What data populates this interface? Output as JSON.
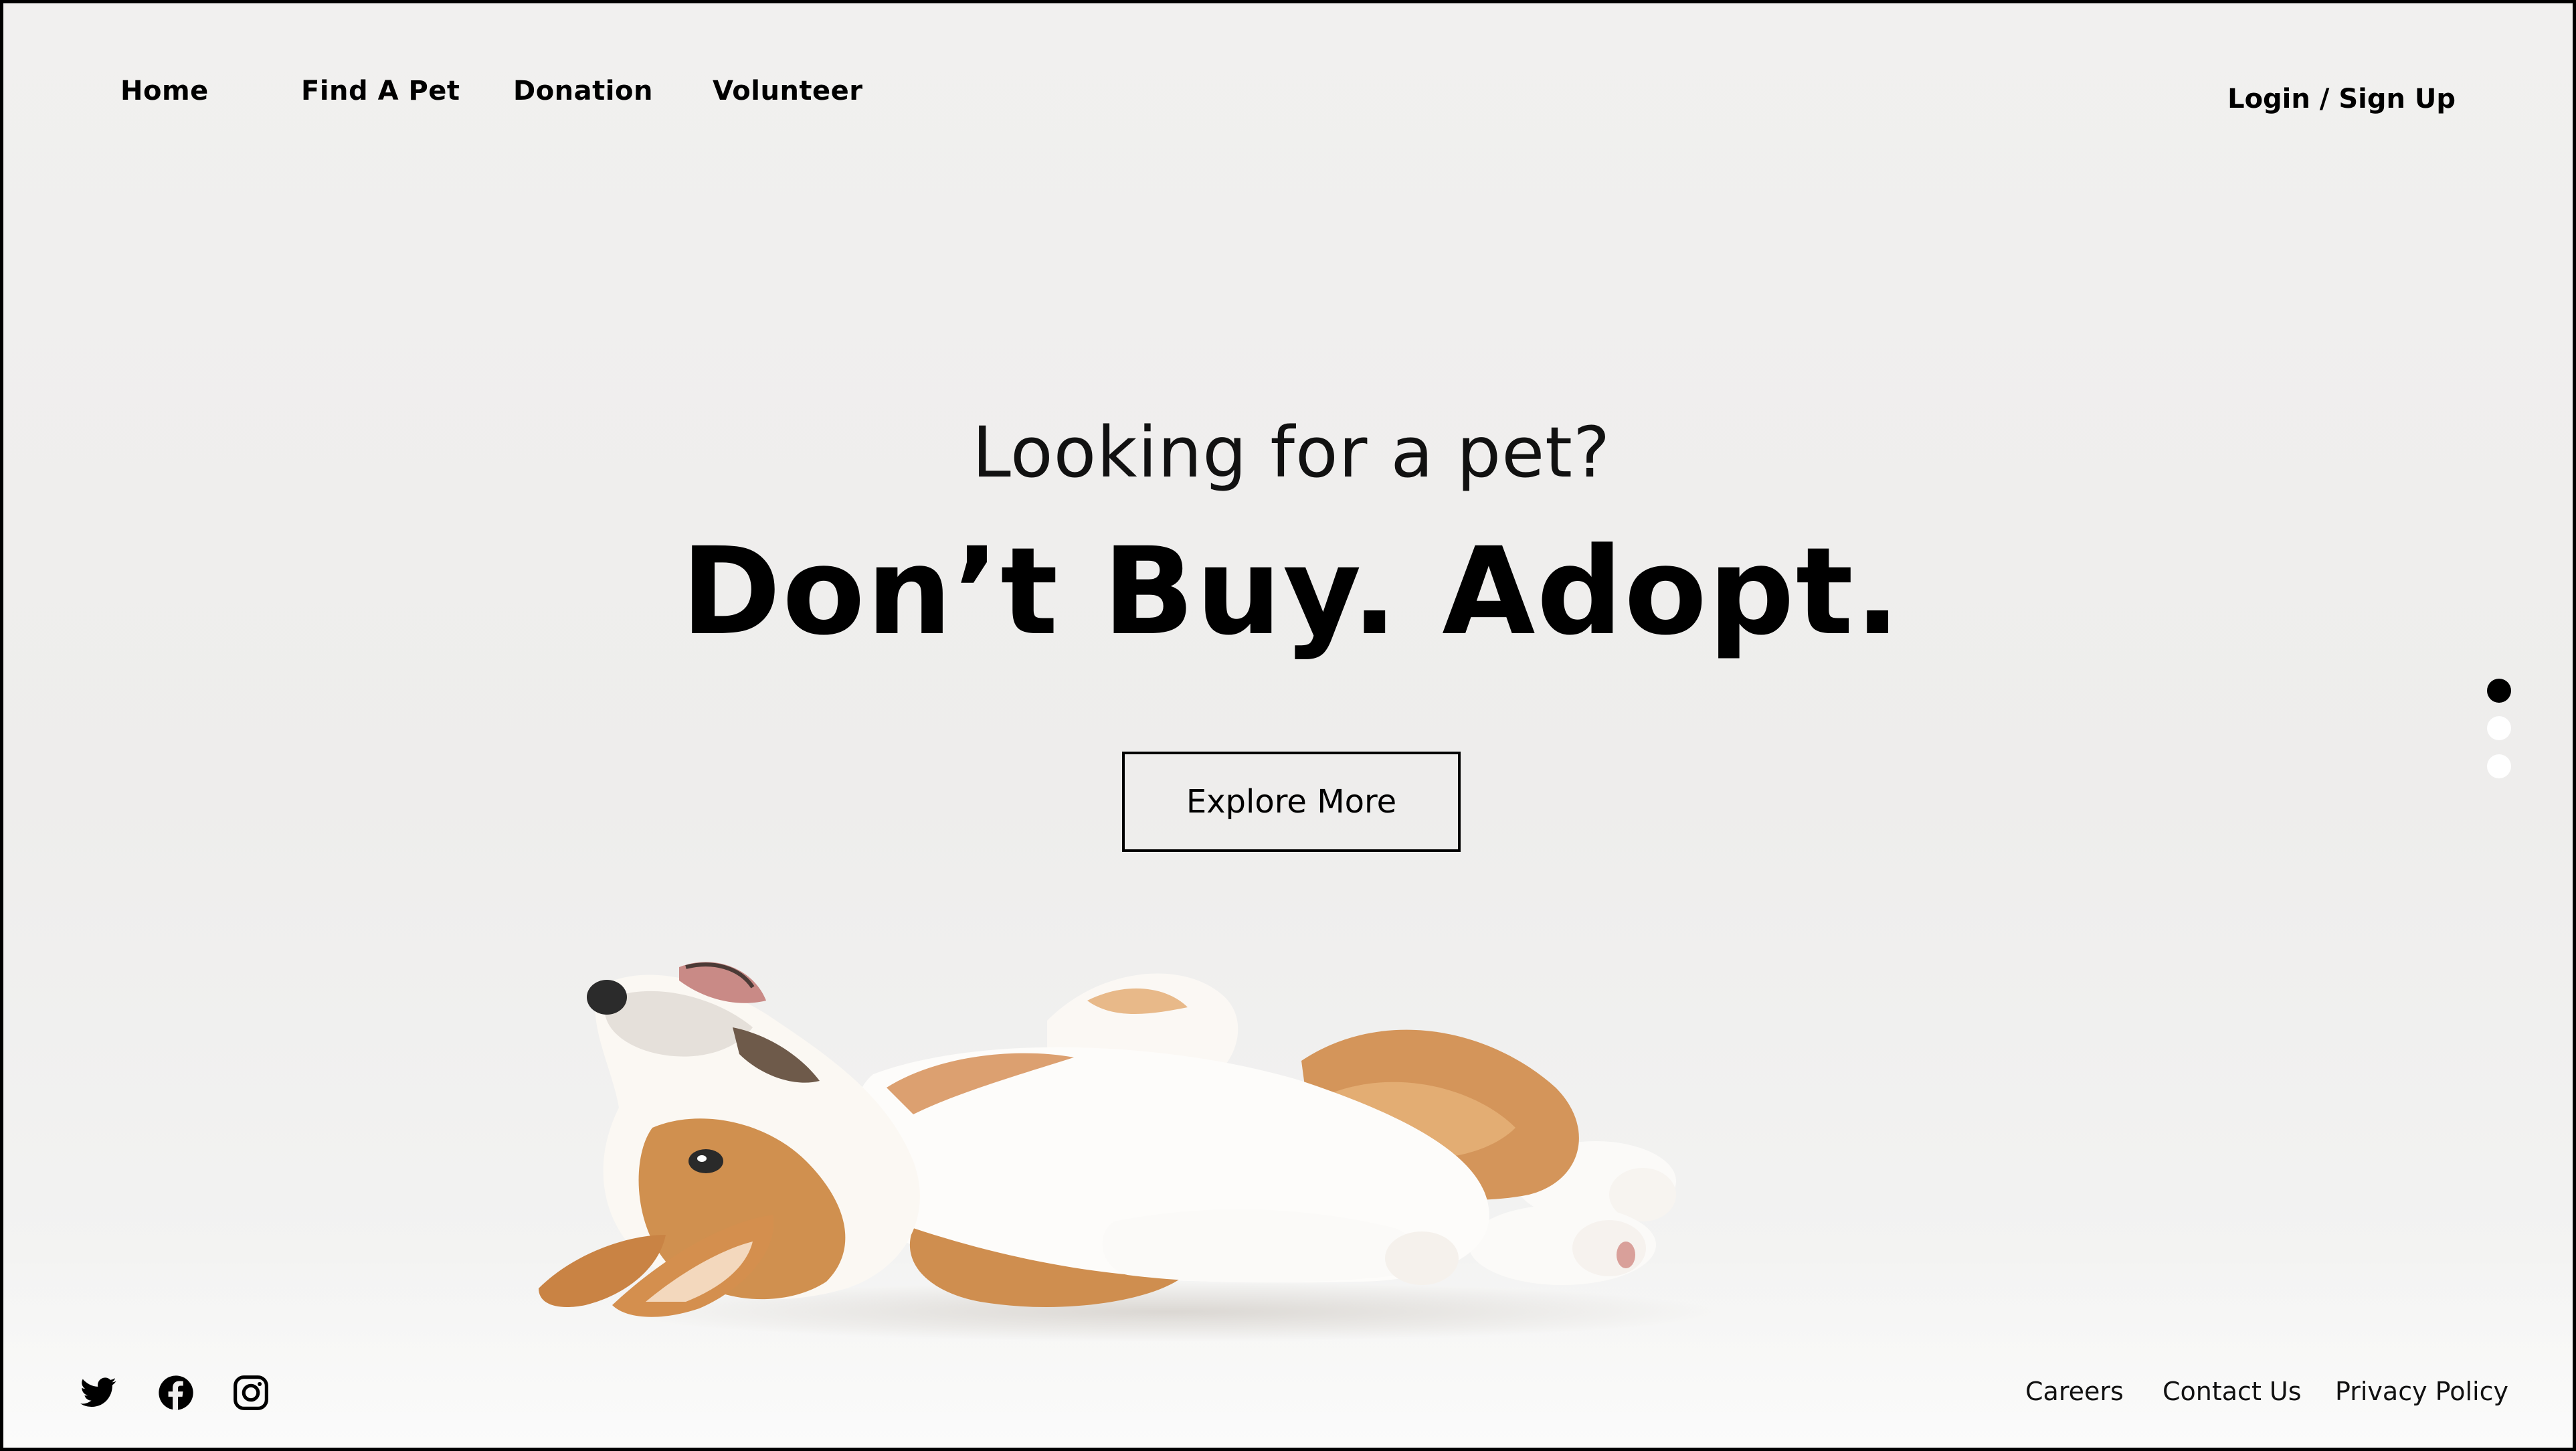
{
  "nav": {
    "items": [
      {
        "label": "Home"
      },
      {
        "label": "Find A Pet"
      },
      {
        "label": "Donation"
      },
      {
        "label": "Volunteer"
      }
    ],
    "login_label": "Login / Sign Up"
  },
  "hero": {
    "subtitle": "Looking for a pet?",
    "title": "Don’t Buy. Adopt.",
    "cta_label": "Explore More"
  },
  "carousel": {
    "slide_count": 3,
    "active_index": 0
  },
  "image": {
    "subject": "corgi puppy lying on its back"
  },
  "footer": {
    "social_icons": [
      "twitter-icon",
      "facebook-icon",
      "instagram-icon"
    ],
    "links": [
      {
        "label": "Careers"
      },
      {
        "label": "Contact Us"
      },
      {
        "label": "Privacy Policy"
      }
    ]
  },
  "colors": {
    "background": "#efeeed",
    "text": "#000000",
    "accent": "#000000",
    "dog_fur_orange": "#d4955a",
    "dog_fur_white": "#fbfaf8"
  }
}
